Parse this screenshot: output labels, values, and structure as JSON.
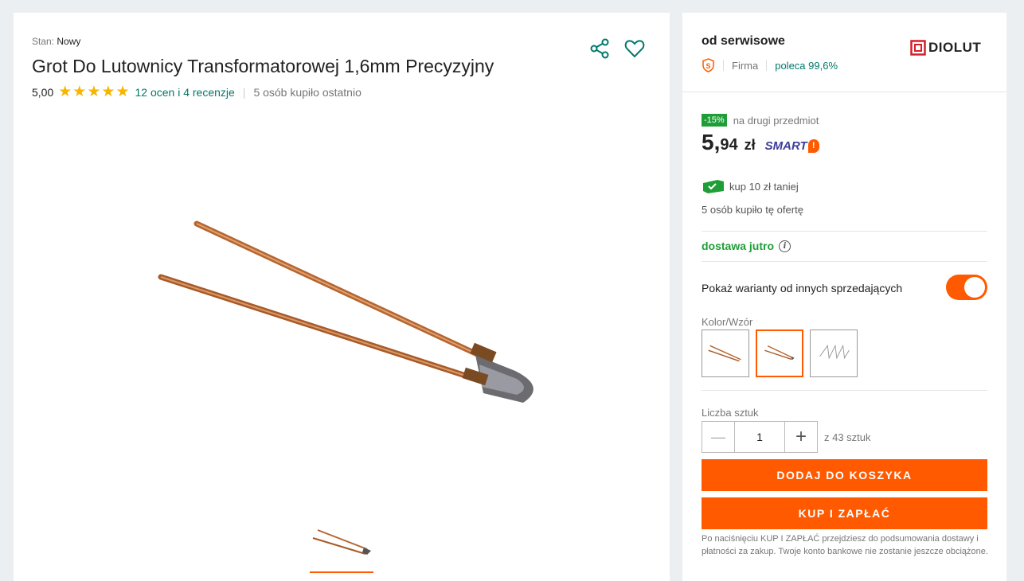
{
  "product": {
    "condition_label": "Stan:",
    "condition_value": "Nowy",
    "title": "Grot Do Lutownicy Transformatorowej 1,6mm Precyzyjny",
    "rating_value": "5,00",
    "stars": 5,
    "reviews_link": "12 ocen i 4 recenzje",
    "bought_recently": "5 osób kupiło ostatnio",
    "thumbnails": [
      "product-thumb"
    ]
  },
  "seller": {
    "name": "od serwisowe",
    "type": "Firma",
    "recommend": "poleca 99,6%",
    "brand": "DIOLUT"
  },
  "offer": {
    "discount_badge": "-15%",
    "discount_text": "na drugi przedmiot",
    "price_int": "5,",
    "price_dec": "94",
    "currency": "zł",
    "smart_label": "SMART",
    "smart_bang": "!",
    "coupon_text": "kup 10 zł taniej",
    "offer_bought": "5 osób kupiło tę ofertę",
    "delivery": "dostawa jutro",
    "info_glyph": "i",
    "variants_toggle_label": "Pokaż warianty od innych sprzedających",
    "variants_toggle_on": true,
    "color_label": "Kolor/Wzór",
    "selected_swatch": 1,
    "quantity_label": "Liczba sztuk",
    "quantity_value": "1",
    "quantity_of": "z 43 sztuk",
    "minus": "—",
    "plus": "+",
    "add_to_cart": "DODAJ DO KOSZYKA",
    "buy_now": "KUP I ZAPŁAĆ",
    "disclaimer": "Po naciśnięciu KUP I ZAPŁAĆ przejdziesz do podsumowania dostawy i płatności za zakup. Twoje konto bankowe nie zostanie jeszcze obciążone."
  },
  "colors": {
    "accent": "#ff5a00",
    "link": "#00796b",
    "success": "#1f9e38",
    "star": "#f7b500"
  },
  "icons": [
    "share-icon",
    "heart-icon",
    "star-icon",
    "super-seller-icon",
    "info-icon",
    "coupon-icon",
    "minus-icon",
    "plus-icon"
  ]
}
